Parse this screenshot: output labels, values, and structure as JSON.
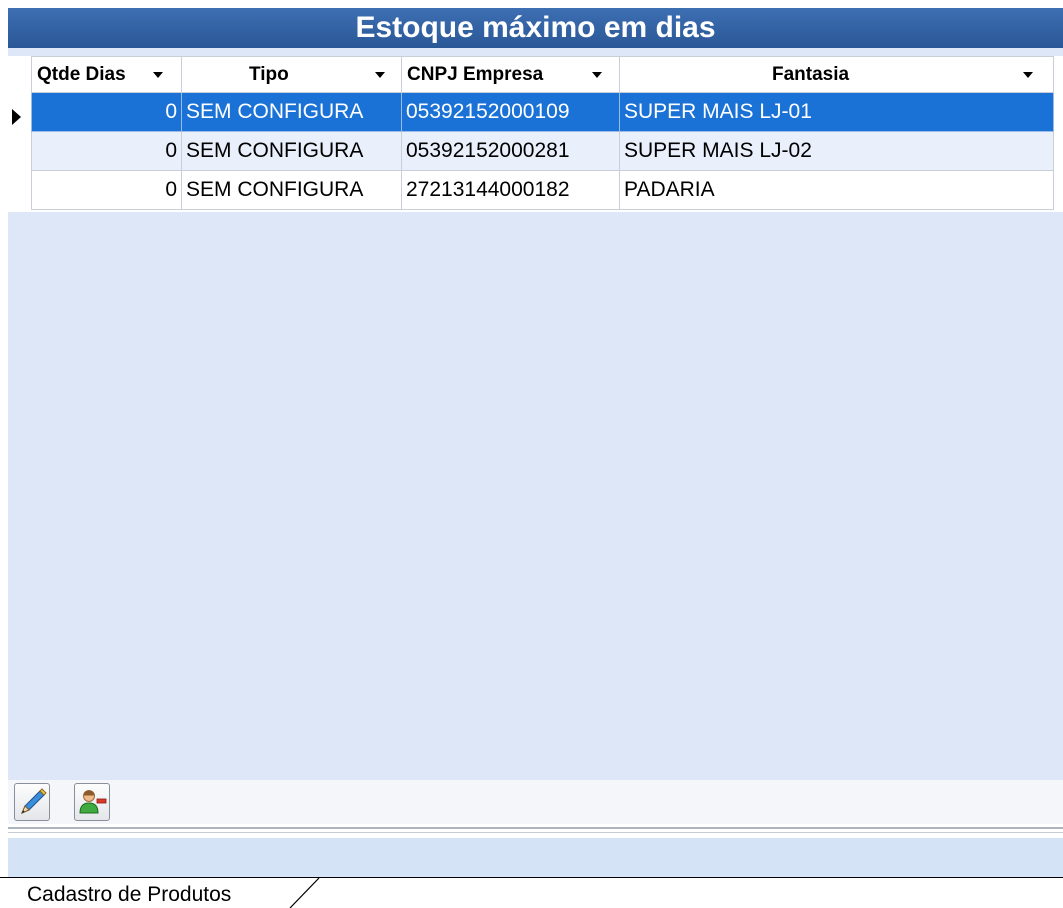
{
  "title": "Estoque máximo em dias",
  "columns": [
    "Qtde Dias",
    "Tipo",
    "CNPJ Empresa",
    "Fantasia"
  ],
  "rows": [
    {
      "qtde": "0",
      "tipo": "SEM CONFIGURA",
      "cnpj": "05392152000109",
      "fantasia": "SUPER MAIS LJ-01"
    },
    {
      "qtde": "0",
      "tipo": "SEM CONFIGURA",
      "cnpj": "05392152000281",
      "fantasia": "SUPER MAIS LJ-02"
    },
    {
      "qtde": "0",
      "tipo": "SEM CONFIGURA",
      "cnpj": "27213144000182",
      "fantasia": "PADARIA"
    }
  ],
  "selected_row": 0,
  "toolbar": {
    "buttons": [
      {
        "icon": "edit-pencil-icon"
      },
      {
        "icon": "user-remove-icon"
      }
    ]
  },
  "tab": {
    "label": "Cadastro de Produtos"
  },
  "colors": {
    "title_bar": "#2f60a4",
    "selection": "#1a72d6",
    "panel_background": "#dde7f8"
  }
}
